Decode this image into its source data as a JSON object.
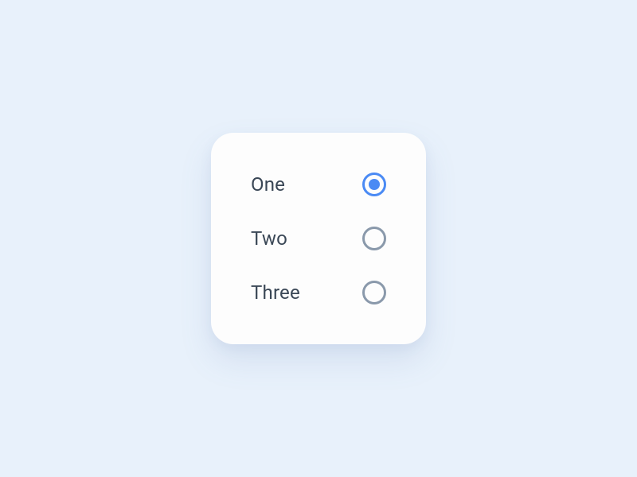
{
  "options": [
    {
      "label": "One",
      "selected": true
    },
    {
      "label": "Two",
      "selected": false
    },
    {
      "label": "Three",
      "selected": false
    }
  ],
  "colors": {
    "background": "#e8f1fb",
    "card": "#fdfdfd",
    "text": "#3a4756",
    "radio_unselected": "#8a99ab",
    "radio_selected": "#4a8af4"
  }
}
